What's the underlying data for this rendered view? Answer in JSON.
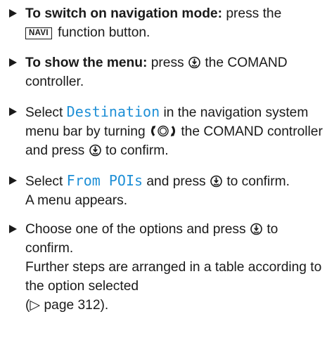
{
  "steps": [
    {
      "bold": "To switch on navigation mode:",
      "text_before_key": "press the",
      "key_label": "NAVI",
      "text_after_key": "function button."
    },
    {
      "bold": "To show the menu:",
      "text_before_icon": "press",
      "icon": "controller-press-icon",
      "text_after_icon": "the COMAND controller."
    },
    {
      "text_before_display": "Select",
      "display": "Destination",
      "text_before_turn_icon": "in the navigation system menu bar by turning",
      "turn_icon": "controller-turn-icon",
      "text_after_turn_icon": "the COMAND controller and press",
      "press_icon": "controller-press-icon",
      "text_end": "to confirm."
    },
    {
      "text_before_display": "Select",
      "display": "From POIs",
      "text_before_icon": "and press",
      "press_icon": "controller-press-icon",
      "text_after_icon": "to confirm.",
      "result": "A menu appears."
    },
    {
      "text_before_icon": "Choose one of the options and press",
      "press_icon": "controller-press-icon",
      "text_after_icon": "to confirm.",
      "result_text": "Further steps are arranged in a table according to the option selected",
      "page_ref_symbol": "▷",
      "page_ref": "page 312"
    }
  ]
}
